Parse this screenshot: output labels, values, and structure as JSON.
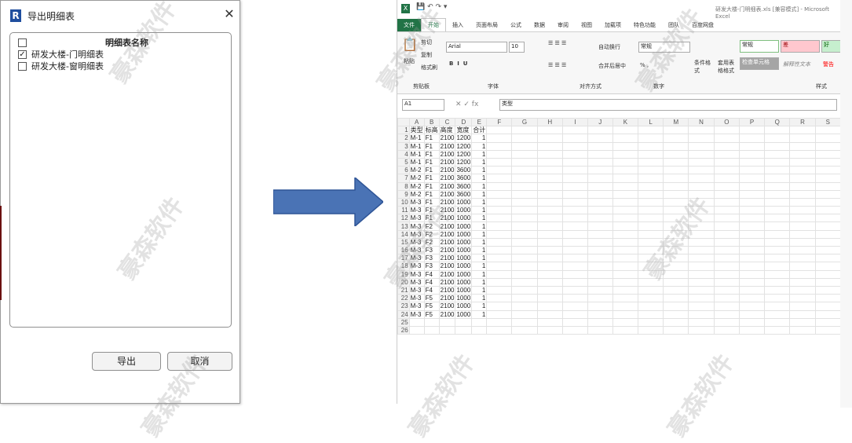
{
  "dialog": {
    "title": "导出明细表",
    "logo_letter": "R",
    "close_glyph": "✕",
    "list_header": "明细表名称",
    "items": [
      {
        "label": "研发大楼-门明细表",
        "checked": true
      },
      {
        "label": "研发大楼-窗明细表",
        "checked": false
      }
    ],
    "export_button": "导出",
    "cancel_button": "取消"
  },
  "excel": {
    "window_title": "研发大楼-门明细表.xls [兼容模式] - Microsoft Excel",
    "tabs": [
      "文件",
      "开始",
      "插入",
      "页面布局",
      "公式",
      "数据",
      "审阅",
      "视图",
      "加载项",
      "特色功能",
      "团队",
      "百度网盘"
    ],
    "active_tab": "开始",
    "ribbon": {
      "paste": "粘贴",
      "cut": "剪切",
      "copy": "复制",
      "format_painter": "格式刷",
      "clipboard_group": "剪贴板",
      "font_name": "Arial",
      "font_size": "10",
      "font_group": "字体",
      "wrap_text": "自动换行",
      "merge_center": "合并后居中",
      "alignment_group": "对齐方式",
      "number_format": "常规",
      "number_group": "数字",
      "conditional_format": "条件格式",
      "table_format": "套用表格格式",
      "styles_group": "样式",
      "style_normal": "常规",
      "style_bad": "差",
      "style_good": "好",
      "style_check": "检查单元格",
      "style_explanatory": "解释性文本",
      "style_warning": "警告"
    },
    "name_box": "A1",
    "formula_value": "类型",
    "columns": [
      "A",
      "B",
      "C",
      "D",
      "E",
      "F",
      "G",
      "H",
      "I",
      "J",
      "K",
      "L",
      "M",
      "N",
      "O",
      "P",
      "Q",
      "R",
      "S"
    ],
    "header_row": [
      "类型",
      "标高",
      "高度",
      "宽度",
      "合计"
    ],
    "rows": [
      [
        "M-1",
        "F1",
        "2100",
        "1200",
        "1"
      ],
      [
        "M-1",
        "F1",
        "2100",
        "1200",
        "1"
      ],
      [
        "M-1",
        "F1",
        "2100",
        "1200",
        "1"
      ],
      [
        "M-1",
        "F1",
        "2100",
        "1200",
        "1"
      ],
      [
        "M-2",
        "F1",
        "2100",
        "3600",
        "1"
      ],
      [
        "M-2",
        "F1",
        "2100",
        "3600",
        "1"
      ],
      [
        "M-2",
        "F1",
        "2100",
        "3600",
        "1"
      ],
      [
        "M-2",
        "F1",
        "2100",
        "3600",
        "1"
      ],
      [
        "M-3",
        "F1",
        "2100",
        "1000",
        "1"
      ],
      [
        "M-3",
        "F1",
        "2100",
        "1000",
        "1"
      ],
      [
        "M-3",
        "F1",
        "2100",
        "1000",
        "1"
      ],
      [
        "M-3",
        "F2",
        "2100",
        "1000",
        "1"
      ],
      [
        "M-3",
        "F2",
        "2100",
        "1000",
        "1"
      ],
      [
        "M-3",
        "F2",
        "2100",
        "1000",
        "1"
      ],
      [
        "M-3",
        "F3",
        "2100",
        "1000",
        "1"
      ],
      [
        "M-3",
        "F3",
        "2100",
        "1000",
        "1"
      ],
      [
        "M-3",
        "F3",
        "2100",
        "1000",
        "1"
      ],
      [
        "M-3",
        "F4",
        "2100",
        "1000",
        "1"
      ],
      [
        "M-3",
        "F4",
        "2100",
        "1000",
        "1"
      ],
      [
        "M-3",
        "F4",
        "2100",
        "1000",
        "1"
      ],
      [
        "M-3",
        "F5",
        "2100",
        "1000",
        "1"
      ],
      [
        "M-3",
        "F5",
        "2100",
        "1000",
        "1"
      ],
      [
        "M-3",
        "F5",
        "2100",
        "1000",
        "1"
      ]
    ],
    "empty_rows": [
      25,
      26
    ]
  },
  "watermark": "豪森软件",
  "colors": {
    "arrow": "#4a73b5",
    "excel_green": "#217346",
    "revit_blue": "#1f4e9e"
  }
}
